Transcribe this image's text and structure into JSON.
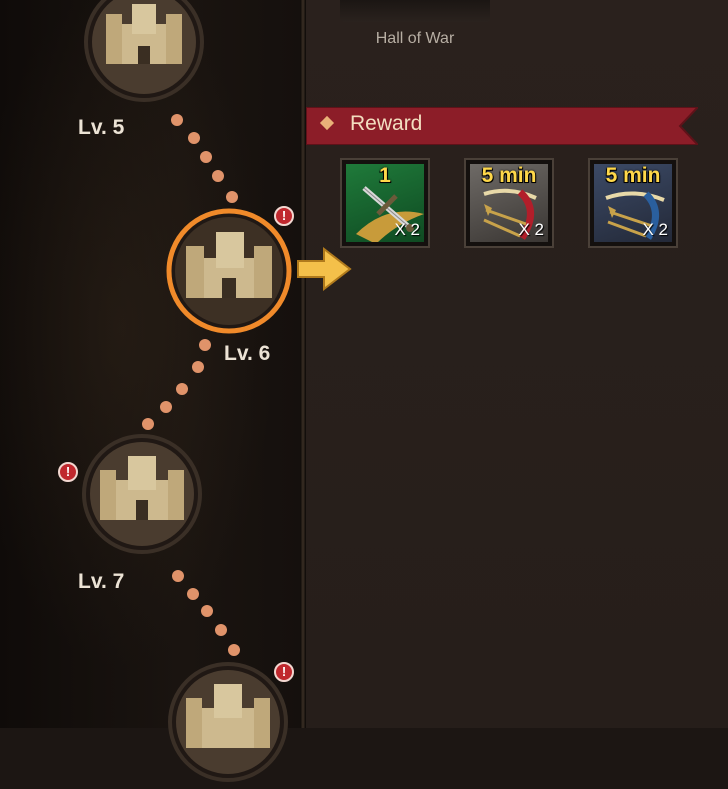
{
  "header": {
    "building_name": "Hall of War"
  },
  "reward": {
    "title": "Reward",
    "items": [
      {
        "icon": "sword-icon",
        "top_label": "1",
        "count": "X 2"
      },
      {
        "icon": "bow-5min-icon",
        "top_label": "5 min",
        "count": "X 2"
      },
      {
        "icon": "crossbow-5min-icon",
        "top_label": "5 min",
        "count": "X 2"
      }
    ]
  },
  "path": {
    "nodes": [
      {
        "label": "Lv. 5",
        "selected": false,
        "alert": false
      },
      {
        "label": "Lv. 6",
        "selected": true,
        "alert": true
      },
      {
        "label": "Lv. 7",
        "selected": false,
        "alert": true
      },
      {
        "label": "",
        "selected": false,
        "alert": true
      }
    ]
  },
  "colors": {
    "accent": "#f08a2a",
    "banner": "#8c1d28",
    "dot": "#e0936a",
    "alert": "#c0282e",
    "count_gold": "#ffd84a"
  }
}
